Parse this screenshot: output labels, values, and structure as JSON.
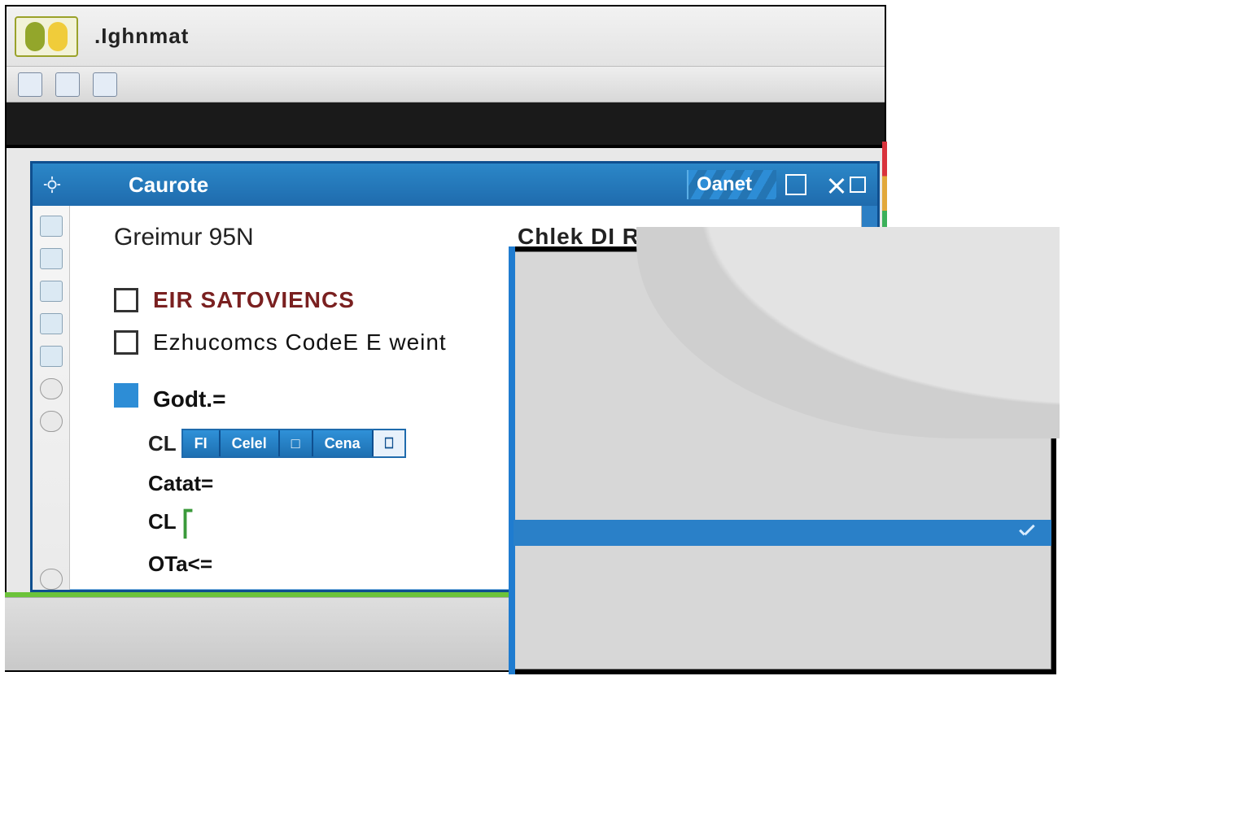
{
  "colors": {
    "accent": "#1f7cd0",
    "titlebar": "#2b87c8",
    "green": "#6cc33a"
  },
  "outer_window": {
    "title": ".Ighnmat",
    "toolbar_icons": [
      "page-icon",
      "table-icon",
      "grid-icon"
    ]
  },
  "blue_window": {
    "title_left": "Caurote",
    "title_right": "Oanet",
    "system_icon": "gear-icon",
    "buttons": {
      "minimize": "minimize-icon",
      "maximize": "maximize-icon",
      "close": "close-icon"
    },
    "sidebar_icons": [
      "doc-icon",
      "doc2-icon",
      "chart-icon",
      "chart2-icon",
      "image-icon",
      "stop-icon",
      "pause-icon",
      "record-icon"
    ],
    "heading_left": "Greimur 95N",
    "heading_right": "Chlek  DI  RI  Solol",
    "checkboxes": [
      {
        "checked": false,
        "label": "EIR SATOVIENCS",
        "style": "red"
      },
      {
        "checked": false,
        "label": "Ezhucomcs CodeE E weint",
        "style": "normal"
      },
      {
        "checked": true,
        "label": "Godt.=",
        "style": "bold"
      }
    ],
    "token_group": {
      "prefix": "CL",
      "tokens": [
        "FI",
        "Celel",
        "□",
        "Cena",
        "⎕"
      ]
    },
    "lines": [
      "Catat=",
      "CL",
      "OTa<="
    ]
  },
  "overlay": {
    "selected_row_checked": true
  }
}
